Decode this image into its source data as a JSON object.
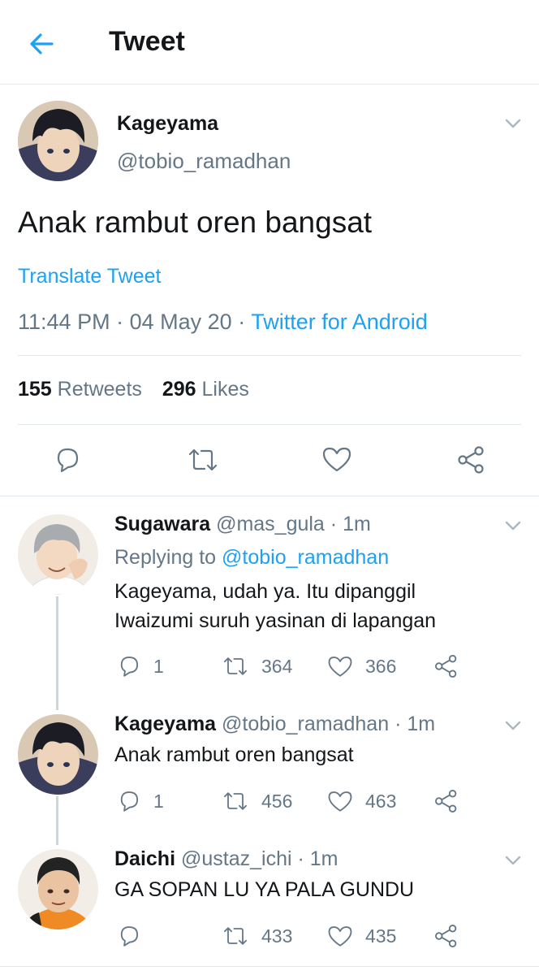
{
  "header": {
    "title": "Tweet",
    "back_icon": "arrow-left-icon",
    "accent_color": "#1da1f2"
  },
  "main_tweet": {
    "display_name": "Kageyama",
    "handle": "@tobio_ramadhan",
    "text": "Anak rambut oren bangsat",
    "translate_label": "Translate Tweet",
    "time": "11:44 PM",
    "sep1": "·",
    "date": "04 May 20",
    "sep2": "·",
    "source": "Twitter for Android",
    "retweet_count": "155",
    "retweet_label": "Retweets",
    "like_count": "296",
    "like_label": "Likes"
  },
  "replies": [
    {
      "display_name": "Sugawara",
      "handle": "@mas_gula",
      "time": "· 1m",
      "replying_to_label": "Replying to",
      "replying_to_handle": "@tobio_ramadhan",
      "text_line1": "Kageyama, udah ya. Itu dipanggil",
      "text_line2": "Iwaizumi suruh yasinan di lapangan",
      "reply_count": "1",
      "retweet_count": "364",
      "like_count": "366"
    },
    {
      "display_name": "Kageyama",
      "handle": "@tobio_ramadhan",
      "time": "· 1m",
      "text_line1": "Anak rambut oren bangsat",
      "reply_count": "1",
      "retweet_count": "456",
      "like_count": "463"
    },
    {
      "display_name": "Daichi",
      "handle": "@ustaz_ichi",
      "time": "· 1m",
      "text_line1": "GA SOPAN LU YA PALA GUNDU",
      "reply_count": "",
      "retweet_count": "433",
      "like_count": "435"
    }
  ]
}
